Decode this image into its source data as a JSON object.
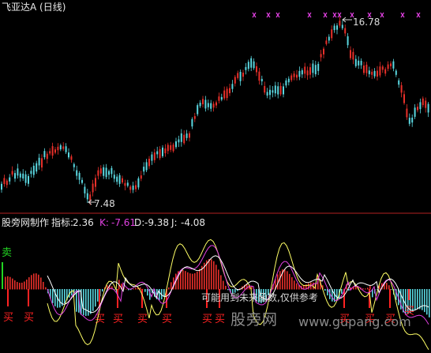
{
  "header": {
    "title": "飞亚达A (日线)"
  },
  "price_panel": {
    "high_label": "16.78",
    "low_label": "7.48"
  },
  "indicator_panel": {
    "name": "股旁网制作",
    "indicator_label": "指标:",
    "indicator_value": "2.36",
    "k_label": "K:",
    "k_value": "-7.61",
    "d_label": "D:",
    "d_value": "-9.38",
    "j_label": "J:",
    "j_value": "-4.08",
    "sell_tag": "卖",
    "buy_glyph": "买",
    "disclaimer": "可能用到未来函数,仅供参考"
  },
  "watermark": {
    "brand": "股旁网",
    "url": "www.gupang.com"
  },
  "colors": {
    "up": "#e8302a",
    "down": "#5ad7e0",
    "k_line": "#e040e0",
    "d_line": "#ffffff",
    "j_line": "#ffff66",
    "buy_marker": "#ff2222",
    "sell_marker": "#22d422",
    "signal_x": "#e040e0",
    "divider": "#b22222"
  }
}
